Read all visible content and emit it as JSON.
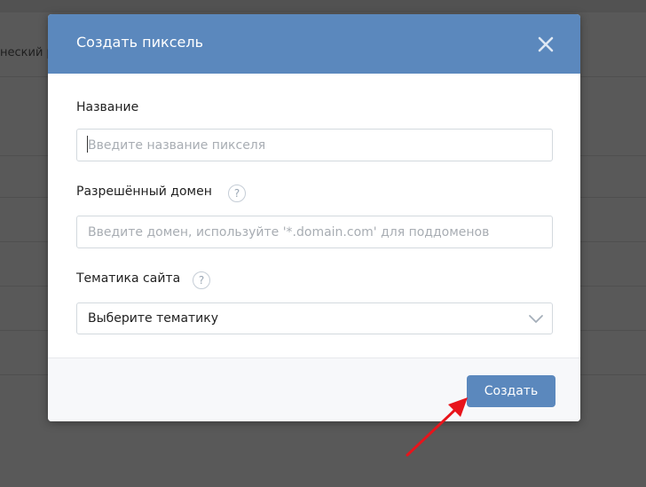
{
  "background": {
    "partial_text": "неский р"
  },
  "modal": {
    "title": "Создать пиксель",
    "close_icon": "close-icon",
    "fields": {
      "name": {
        "label": "Название",
        "placeholder": "Введите название пикселя",
        "value": ""
      },
      "domain": {
        "label": "Разрешённый домен",
        "help": "?",
        "placeholder": "Введите домен, используйте '*.domain.com' для поддоменов",
        "value": ""
      },
      "topic": {
        "label": "Тематика сайта",
        "help": "?",
        "selected": "Выберите тематику",
        "chevron_icon": "chevron-down-icon"
      }
    },
    "footer": {
      "create_label": "Создать"
    }
  },
  "annotation": {
    "icon": "red-arrow-icon",
    "color": "#e8141b"
  },
  "colors": {
    "header": "#5b88bd",
    "button": "#5b88bd",
    "overlay": "#595959"
  }
}
